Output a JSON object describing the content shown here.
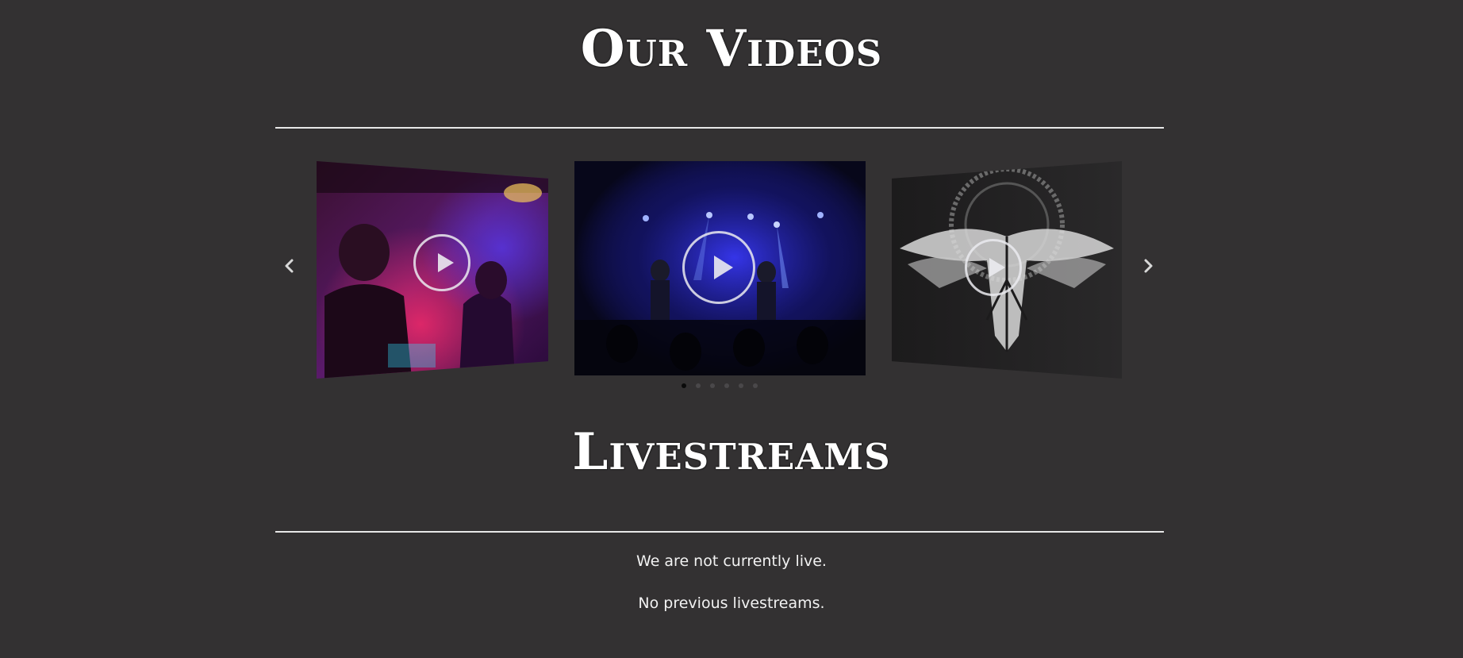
{
  "videos": {
    "title": "Our Videos",
    "prev_icon": "chevron-left-icon",
    "next_icon": "chevron-right-icon",
    "slides": [
      {
        "position": "left",
        "kind": "band performance photo",
        "play_icon": "play-circle-icon"
      },
      {
        "position": "center",
        "kind": "concert stage photo",
        "play_icon": "play-circle-icon"
      },
      {
        "position": "right",
        "kind": "band logo artwork",
        "play_icon": "play-circle-icon"
      }
    ],
    "dots": [
      true,
      false,
      false,
      false,
      false,
      false
    ]
  },
  "livestreams": {
    "title": "Livestreams",
    "status_text": "We are not currently live.",
    "previous_text": "No previous livestreams."
  },
  "colors": {
    "background": "#333132",
    "text": "#ffffff",
    "divider": "#e8e8e8",
    "dot_active": "#0a0a0a",
    "dot_inactive": "#4a484a"
  }
}
